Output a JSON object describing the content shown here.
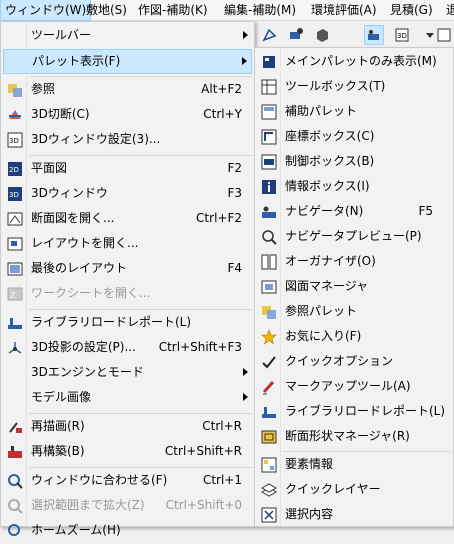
{
  "menubar": {
    "items": [
      {
        "label": "ウィンドウ(W)"
      },
      {
        "label": "敷地(S)"
      },
      {
        "label": "作図-補助(K)"
      },
      {
        "label": "編集-補助(M)"
      },
      {
        "label": "環境評価(A)"
      },
      {
        "label": "見積(G)"
      },
      {
        "label": "退"
      }
    ]
  },
  "main_menu": {
    "items": [
      {
        "label": "ツールバー",
        "shortcut": "",
        "icon": "none"
      },
      {
        "label": "パレット表示(F)",
        "shortcut": "",
        "icon": "none"
      },
      {
        "label": "参照",
        "shortcut": "Alt+F2",
        "icon": "reference-icon"
      },
      {
        "label": "3D切断(C)",
        "shortcut": "Ctrl+Y",
        "icon": "3d-cut-icon"
      },
      {
        "label": "3Dウィンドウ設定(3)...",
        "shortcut": "",
        "icon": "3d-window-settings-icon"
      },
      {
        "label": "平面図",
        "shortcut": "F2",
        "icon": "floor-plan-icon"
      },
      {
        "label": "3Dウィンドウ",
        "shortcut": "F3",
        "icon": "3d-window-icon"
      },
      {
        "label": "断面図を開く...",
        "shortcut": "Ctrl+F2",
        "icon": "section-icon"
      },
      {
        "label": "レイアウトを開く...",
        "shortcut": "",
        "icon": "layout-icon"
      },
      {
        "label": "最後のレイアウト",
        "shortcut": "F4",
        "icon": "last-layout-icon"
      },
      {
        "label": "ワークシートを開く...",
        "shortcut": "",
        "icon": "worksheet-icon"
      },
      {
        "label": "ライブラリロードレポート(L)",
        "shortcut": "",
        "icon": "library-report-icon"
      },
      {
        "label": "3D投影の設定(P)...",
        "shortcut": "Ctrl+Shift+F3",
        "icon": "3d-projection-icon"
      },
      {
        "label": "3Dエンジンとモード",
        "shortcut": "",
        "icon": "none"
      },
      {
        "label": "モデル画像",
        "shortcut": "",
        "icon": "none"
      },
      {
        "label": "再描画(R)",
        "shortcut": "Ctrl+R",
        "icon": "redraw-icon"
      },
      {
        "label": "再構築(B)",
        "shortcut": "Ctrl+Shift+R",
        "icon": "rebuild-icon"
      },
      {
        "label": "ウィンドウに合わせる(F)",
        "shortcut": "Ctrl+1",
        "icon": "fit-window-icon"
      },
      {
        "label": "選択範囲まで拡大(Z)",
        "shortcut": "Ctrl+Shift+0",
        "icon": "zoom-selection-icon"
      },
      {
        "label": "ホームズーム(H)",
        "shortcut": "",
        "icon": "home-zoom-icon"
      }
    ]
  },
  "sub_menu": {
    "items": [
      {
        "label": "メインパレットのみ表示(M)",
        "shortcut": "",
        "icon": "main-palette-icon"
      },
      {
        "label": "ツールボックス(T)",
        "shortcut": "",
        "icon": "toolbox-icon"
      },
      {
        "label": "補助パレット",
        "shortcut": "",
        "icon": "aux-palette-icon"
      },
      {
        "label": "座標ボックス(C)",
        "shortcut": "",
        "icon": "coordinate-box-icon"
      },
      {
        "label": "制御ボックス(B)",
        "shortcut": "",
        "icon": "control-box-icon"
      },
      {
        "label": "情報ボックス(I)",
        "shortcut": "",
        "icon": "info-box-icon"
      },
      {
        "label": "ナビゲータ(N)",
        "shortcut": "F5",
        "icon": "navigator-icon"
      },
      {
        "label": "ナビゲータプレビュー(P)",
        "shortcut": "",
        "icon": "navigator-preview-icon"
      },
      {
        "label": "オーガナイザ(O)",
        "shortcut": "",
        "icon": "organizer-icon"
      },
      {
        "label": "図面マネージャ",
        "shortcut": "",
        "icon": "drawing-manager-icon"
      },
      {
        "label": "参照パレット",
        "shortcut": "",
        "icon": "reference-palette-icon"
      },
      {
        "label": "お気に入り(F)",
        "shortcut": "",
        "icon": "favorites-star-icon"
      },
      {
        "label": "クイックオプション",
        "shortcut": "",
        "icon": "quick-options-icon"
      },
      {
        "label": "マークアップツール(A)",
        "shortcut": "",
        "icon": "markup-tool-icon"
      },
      {
        "label": "ライブラリロードレポート(L)",
        "shortcut": "",
        "icon": "library-report-icon"
      },
      {
        "label": "断面形状マネージャ(R)",
        "shortcut": "",
        "icon": "profile-manager-icon"
      },
      {
        "label": "要素情報",
        "shortcut": "",
        "icon": "element-info-icon"
      },
      {
        "label": "クイックレイヤー",
        "shortcut": "",
        "icon": "quick-layers-icon"
      },
      {
        "label": "選択内容",
        "shortcut": "",
        "icon": "selection-icon"
      }
    ]
  },
  "colors": {
    "highlight": "#cce8ff",
    "highlight_border": "#99d1ff",
    "menu_bg": "#f2f2f2",
    "disabled_text": "#9a9a9a",
    "menubar_underline": "#1a5fb4"
  }
}
